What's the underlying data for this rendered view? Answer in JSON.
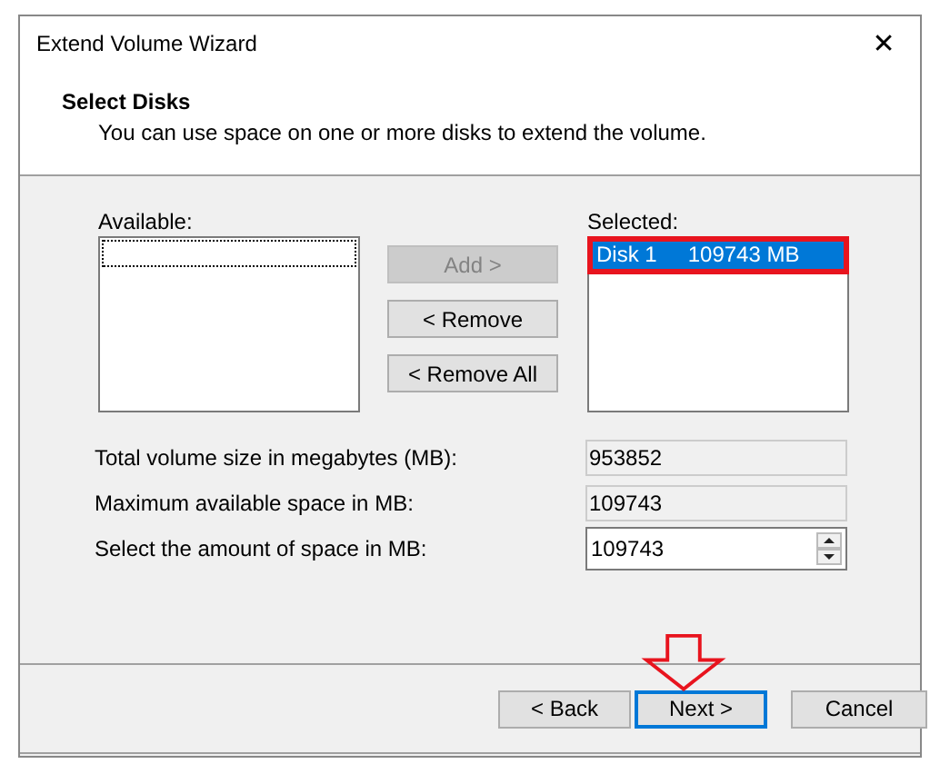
{
  "window": {
    "title": "Extend Volume Wizard",
    "close": "✕"
  },
  "header": {
    "title": "Select Disks",
    "subtitle": "You can use space on one or more disks to extend the volume."
  },
  "available": {
    "label": "Available:",
    "focused_empty_row": true
  },
  "transfer_buttons": [
    {
      "label": "Add >",
      "disabled": true
    },
    {
      "label": "< Remove",
      "disabled": false
    },
    {
      "label": "< Remove All",
      "disabled": false
    }
  ],
  "selected": {
    "label": "Selected:",
    "items": [
      {
        "disk": "Disk 1",
        "size": "109743 MB",
        "selected": true
      }
    ]
  },
  "fields": [
    {
      "label": "Total volume size in megabytes (MB):",
      "value": "953852",
      "kind": "readonly"
    },
    {
      "label": "Maximum available space in MB:",
      "value": "109743",
      "kind": "readonly"
    },
    {
      "label": "Select the amount of space in MB:",
      "value": "109743",
      "kind": "spin"
    }
  ],
  "footer_buttons": [
    {
      "label": "< Back",
      "default": false
    },
    {
      "label": "Next >",
      "default": true
    },
    {
      "label": "Cancel",
      "default": false
    }
  ],
  "annotations": {
    "highlight_frame": true,
    "arrow": true
  }
}
